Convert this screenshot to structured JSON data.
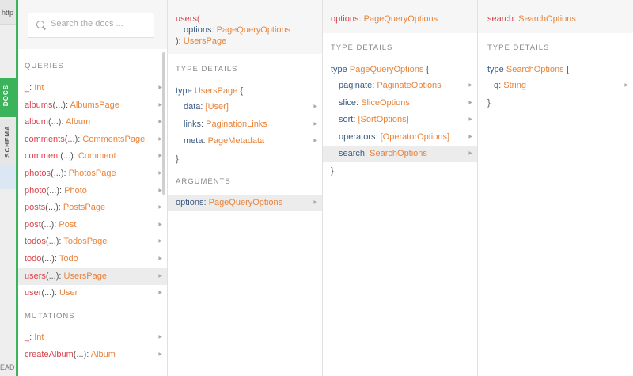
{
  "edge": {
    "url_stub": "http",
    "bottom_stub": "EAD"
  },
  "side_tabs": {
    "docs": "DOCS",
    "schema": "SCHEMA"
  },
  "search": {
    "placeholder": "Search the docs ..."
  },
  "queries_title": "QUERIES",
  "queries": [
    {
      "name": "_",
      "args": "",
      "type": "Int"
    },
    {
      "name": "albums",
      "args": "(...)",
      "type": "AlbumsPage"
    },
    {
      "name": "album",
      "args": "(...)",
      "type": "Album"
    },
    {
      "name": "comments",
      "args": "(...)",
      "type": "CommentsPage"
    },
    {
      "name": "comment",
      "args": "(...)",
      "type": "Comment"
    },
    {
      "name": "photos",
      "args": "(...)",
      "type": "PhotosPage"
    },
    {
      "name": "photo",
      "args": "(...)",
      "type": "Photo"
    },
    {
      "name": "posts",
      "args": "(...)",
      "type": "PostsPage"
    },
    {
      "name": "post",
      "args": "(...)",
      "type": "Post"
    },
    {
      "name": "todos",
      "args": "(...)",
      "type": "TodosPage"
    },
    {
      "name": "todo",
      "args": "(...)",
      "type": "Todo"
    },
    {
      "name": "users",
      "args": "(...)",
      "type": "UsersPage"
    },
    {
      "name": "user",
      "args": "(...)",
      "type": "User"
    }
  ],
  "mutations_title": "MUTATIONS",
  "mutations": [
    {
      "name": "_",
      "args": "",
      "type": "Int"
    },
    {
      "name": "createAlbum",
      "args": "(...)",
      "type": "Album"
    }
  ],
  "col2": {
    "header_name": "users(",
    "header_arg_name": "options",
    "header_arg_type": "PageQueryOptions",
    "header_close": "):",
    "header_return": "UsersPage",
    "type_details_title": "TYPE DETAILS",
    "type_kw": "type",
    "type_name": "UsersPage",
    "open_brace": "{",
    "close_brace": "}",
    "fields": [
      {
        "name": "data",
        "type": "[User]"
      },
      {
        "name": "links",
        "type": "PaginationLinks"
      },
      {
        "name": "meta",
        "type": "PageMetadata"
      }
    ],
    "arguments_title": "ARGUMENTS",
    "arguments": [
      {
        "name": "options",
        "type": "PageQueryOptions"
      }
    ]
  },
  "col3": {
    "header_name": "options",
    "header_type": "PageQueryOptions",
    "type_details_title": "TYPE DETAILS",
    "type_kw": "type",
    "type_name": "PageQueryOptions",
    "open_brace": "{",
    "close_brace": "}",
    "fields": [
      {
        "name": "paginate",
        "type": "PaginateOptions"
      },
      {
        "name": "slice",
        "type": "SliceOptions"
      },
      {
        "name": "sort",
        "type": "[SortOptions]"
      },
      {
        "name": "operators",
        "type": "[OperatorOptions]"
      },
      {
        "name": "search",
        "type": "SearchOptions"
      }
    ]
  },
  "col4": {
    "header_name": "search",
    "header_type": "SearchOptions",
    "type_details_title": "TYPE DETAILS",
    "type_kw": "type",
    "type_name": "SearchOptions",
    "open_brace": "{",
    "close_brace": "}",
    "fields": [
      {
        "name": "q",
        "type": "String"
      }
    ]
  },
  "colors": {
    "accent_green": "#3bb35a",
    "field_name": "#d9424a",
    "type_name": "#e8833a",
    "keyword": "#2f5a8f"
  }
}
